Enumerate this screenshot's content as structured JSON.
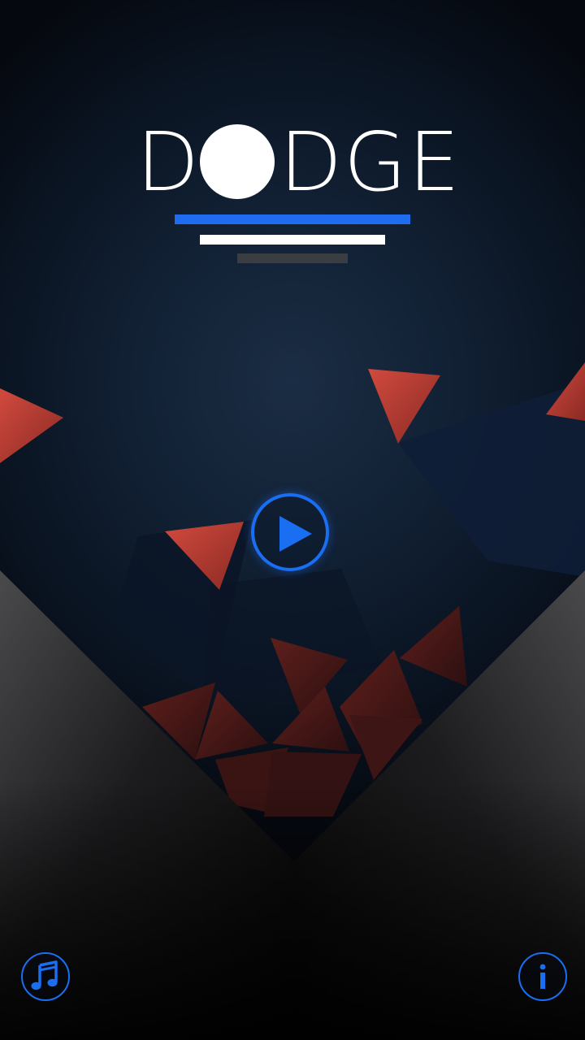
{
  "title": {
    "left": "D",
    "right": "DGE"
  },
  "controls": {
    "play": "play-icon",
    "music": "music-note-icon",
    "info": "info-icon"
  },
  "colors": {
    "accent_blue": "#1f6cf0",
    "triangle_red": "#c8493f",
    "background": "#0a1422"
  }
}
